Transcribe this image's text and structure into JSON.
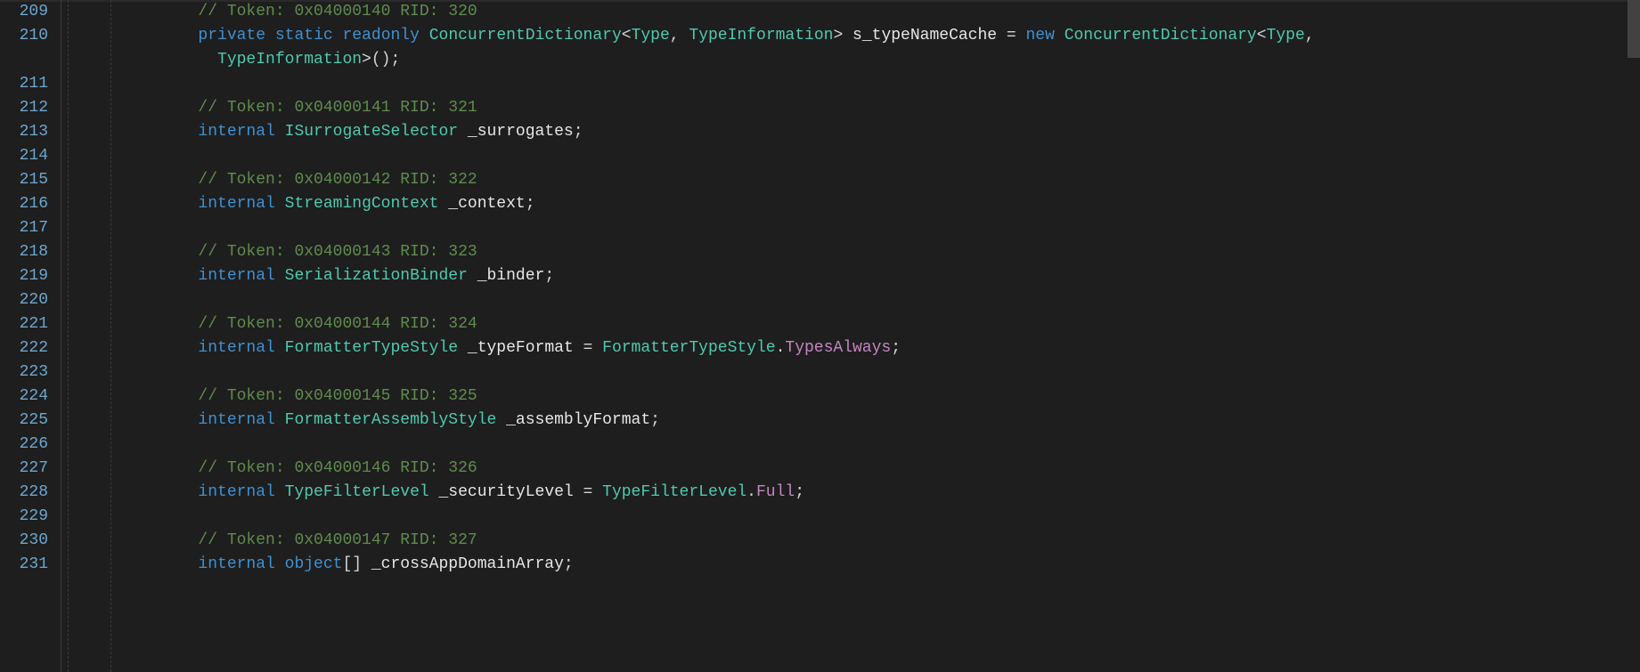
{
  "scroll": {
    "thumbTopPx": 0,
    "thumbHeightPx": 65
  },
  "gutter": {
    "start": 209,
    "lines": [
      209,
      210,
      null,
      211,
      212,
      213,
      214,
      215,
      216,
      217,
      218,
      219,
      220,
      221,
      222,
      223,
      224,
      225,
      226,
      227,
      228,
      229,
      230,
      231
    ]
  },
  "code": {
    "indentCh": 8,
    "lines": [
      {
        "n": 209,
        "tokens": [
          [
            "cmt",
            "// Token: 0x04000140 RID: 320"
          ]
        ]
      },
      {
        "n": 210,
        "tokens": [
          [
            "kw",
            "private"
          ],
          [
            "op",
            " "
          ],
          [
            "kw",
            "static"
          ],
          [
            "op",
            " "
          ],
          [
            "kw",
            "readonly"
          ],
          [
            "op",
            " "
          ],
          [
            "ty",
            "ConcurrentDictionary"
          ],
          [
            "op",
            "<"
          ],
          [
            "ty",
            "Type"
          ],
          [
            "op",
            ", "
          ],
          [
            "ty",
            "TypeInformation"
          ],
          [
            "op",
            "> "
          ],
          [
            "id",
            "s_typeNameCache"
          ],
          [
            "op",
            " = "
          ],
          [
            "kw",
            "new"
          ],
          [
            "op",
            " "
          ],
          [
            "ty",
            "ConcurrentDictionary"
          ],
          [
            "op",
            "<"
          ],
          [
            "ty",
            "Type"
          ],
          [
            "op",
            ", "
          ]
        ]
      },
      {
        "n": null,
        "cont": true,
        "tokens": [
          [
            "ty",
            "TypeInformation"
          ],
          [
            "op",
            ">();"
          ]
        ]
      },
      {
        "n": 211,
        "tokens": []
      },
      {
        "n": 212,
        "tokens": [
          [
            "cmt",
            "// Token: 0x04000141 RID: 321"
          ]
        ]
      },
      {
        "n": 213,
        "tokens": [
          [
            "kw2",
            "internal"
          ],
          [
            "op",
            " "
          ],
          [
            "ty",
            "ISurrogateSelector"
          ],
          [
            "op",
            " "
          ],
          [
            "id",
            "_surrogates"
          ],
          [
            "op",
            ";"
          ]
        ]
      },
      {
        "n": 214,
        "tokens": []
      },
      {
        "n": 215,
        "tokens": [
          [
            "cmt",
            "// Token: 0x04000142 RID: 322"
          ]
        ]
      },
      {
        "n": 216,
        "tokens": [
          [
            "kw2",
            "internal"
          ],
          [
            "op",
            " "
          ],
          [
            "ty",
            "StreamingContext"
          ],
          [
            "op",
            " "
          ],
          [
            "id",
            "_context"
          ],
          [
            "op",
            ";"
          ]
        ]
      },
      {
        "n": 217,
        "tokens": []
      },
      {
        "n": 218,
        "tokens": [
          [
            "cmt",
            "// Token: 0x04000143 RID: 323"
          ]
        ]
      },
      {
        "n": 219,
        "tokens": [
          [
            "kw2",
            "internal"
          ],
          [
            "op",
            " "
          ],
          [
            "ty",
            "SerializationBinder"
          ],
          [
            "op",
            " "
          ],
          [
            "id",
            "_binder"
          ],
          [
            "op",
            ";"
          ]
        ]
      },
      {
        "n": 220,
        "tokens": []
      },
      {
        "n": 221,
        "tokens": [
          [
            "cmt",
            "// Token: 0x04000144 RID: 324"
          ]
        ]
      },
      {
        "n": 222,
        "tokens": [
          [
            "kw2",
            "internal"
          ],
          [
            "op",
            " "
          ],
          [
            "ty",
            "FormatterTypeStyle"
          ],
          [
            "op",
            " "
          ],
          [
            "id",
            "_typeFormat"
          ],
          [
            "op",
            " = "
          ],
          [
            "ty",
            "FormatterTypeStyle"
          ],
          [
            "op",
            "."
          ],
          [
            "mem",
            "TypesAlways"
          ],
          [
            "op",
            ";"
          ]
        ]
      },
      {
        "n": 223,
        "tokens": []
      },
      {
        "n": 224,
        "tokens": [
          [
            "cmt",
            "// Token: 0x04000145 RID: 325"
          ]
        ]
      },
      {
        "n": 225,
        "tokens": [
          [
            "kw2",
            "internal"
          ],
          [
            "op",
            " "
          ],
          [
            "ty",
            "FormatterAssemblyStyle"
          ],
          [
            "op",
            " "
          ],
          [
            "id",
            "_assemblyFormat"
          ],
          [
            "op",
            ";"
          ]
        ]
      },
      {
        "n": 226,
        "tokens": []
      },
      {
        "n": 227,
        "tokens": [
          [
            "cmt",
            "// Token: 0x04000146 RID: 326"
          ]
        ]
      },
      {
        "n": 228,
        "tokens": [
          [
            "kw2",
            "internal"
          ],
          [
            "op",
            " "
          ],
          [
            "ty",
            "TypeFilterLevel"
          ],
          [
            "op",
            " "
          ],
          [
            "id",
            "_securityLevel"
          ],
          [
            "op",
            " = "
          ],
          [
            "ty",
            "TypeFilterLevel"
          ],
          [
            "op",
            "."
          ],
          [
            "mem",
            "Full"
          ],
          [
            "op",
            ";"
          ]
        ]
      },
      {
        "n": 229,
        "tokens": []
      },
      {
        "n": 230,
        "tokens": [
          [
            "cmt",
            "// Token: 0x04000147 RID: 327"
          ]
        ]
      },
      {
        "n": 231,
        "tokens": [
          [
            "kw2",
            "internal"
          ],
          [
            "op",
            " "
          ],
          [
            "kw",
            "object"
          ],
          [
            "op",
            "[] "
          ],
          [
            "id",
            "_crossAppDomainArray"
          ],
          [
            "op",
            ";"
          ]
        ]
      }
    ]
  }
}
